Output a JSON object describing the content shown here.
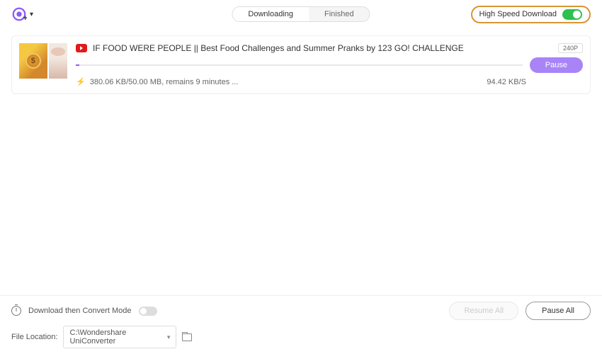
{
  "header": {
    "tabs": {
      "downloading": "Downloading",
      "finished": "Finished"
    },
    "high_speed_label": "High Speed Download"
  },
  "downloads": [
    {
      "title": "IF FOOD WERE PEOPLE ||  Best Food Challenges and Summer Pranks by 123 GO! CHALLENGE",
      "quality": "240P",
      "progress_text": "380.06 KB/50.00 MB, remains 9 minutes ...",
      "speed": "94.42 KB/S",
      "pause_label": "Pause",
      "progress_percent": 0.76
    }
  ],
  "footer": {
    "convert_label": "Download then Convert Mode",
    "resume_all": "Resume All",
    "pause_all": "Pause All",
    "file_location_label": "File Location:",
    "file_location_value": "C:\\Wondershare UniConverter"
  }
}
